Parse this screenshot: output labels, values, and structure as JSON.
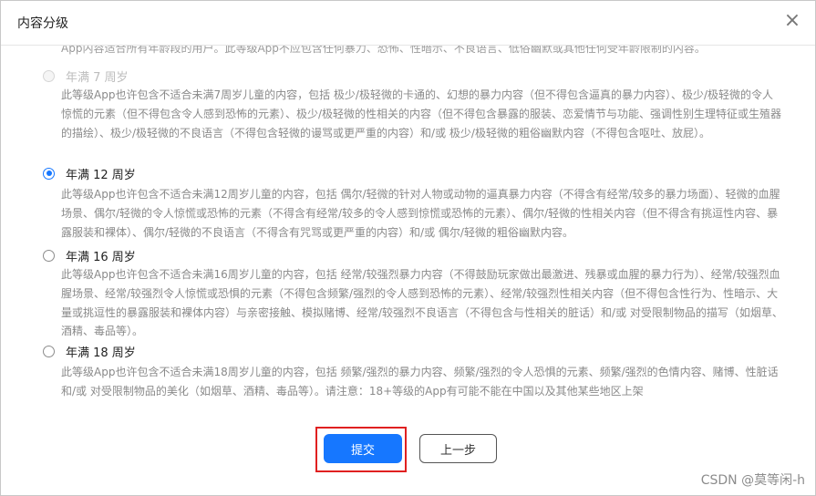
{
  "dialog": {
    "title": "内容分级",
    "close_glyph": "×"
  },
  "clipped_text": "App内容适合所有年龄段的用户。此等级App不应包含任何暴力、恐怖、性暗示、不良语言、低俗幽默或其他任何受年龄限制的内容。",
  "options": [
    {
      "label": "年满 7 周岁",
      "state": "disabled",
      "description": "此等级App也许包含不适合未满7周岁儿童的内容，包括 极少/极轻微的卡通的、幻想的暴力内容（但不得包含逼真的暴力内容）、极少/极轻微的令人惊慌的元素（但不得包含令人感到恐怖的元素）、极少/极轻微的性相关的内容（但不得包含暴露的服装、恋爱情节与功能、强调性别生理特征或生殖器的描绘）、极少/极轻微的不良语言（不得包含轻微的谩骂或更严重的内容）和/或 极少/极轻微的粗俗幽默内容（不得包含呕吐、放屁）。"
    },
    {
      "label": "年满 12 周岁",
      "state": "checked",
      "description": "此等级App也许包含不适合未满12周岁儿童的内容，包括 偶尔/轻微的针对人物或动物的逼真暴力内容（不得含有经常/较多的暴力场面）、轻微的血腥场景、偶尔/轻微的令人惊慌或恐怖的元素（不得含有经常/较多的令人感到惊慌或恐怖的元素）、偶尔/轻微的性相关内容（但不得含有挑逗性内容、暴露服装和裸体）、偶尔/轻微的不良语言（不得含有咒骂或更严重的内容）和/或 偶尔/轻微的粗俗幽默内容。"
    },
    {
      "label": "年满 16 周岁",
      "state": "unchecked",
      "description": "此等级App也许包含不适合未满16周岁儿童的内容，包括 经常/较强烈暴力内容（不得鼓励玩家做出最激进、残暴或血腥的暴力行为）、经常/较强烈血腥场景、经常/较强烈令人惊慌或恐惧的元素（不得包含频繁/强烈的令人感到恐怖的元素）、经常/较强烈性相关内容（但不得包含性行为、性暗示、大量或挑逗性的暴露服装和裸体内容）与亲密接触、模拟赌博、经常/较强烈不良语言（不得包含与性相关的脏话）和/或 对受限制物品的描写（如烟草、酒精、毒品等）。"
    },
    {
      "label": "年满 18 周岁",
      "state": "unchecked",
      "description": "此等级App也许包含不适合未满18周岁儿童的内容，包括 频繁/强烈的暴力内容、频繁/强烈的令人恐惧的元素、频繁/强烈的色情内容、赌博、性脏话和/或 对受限制物品的美化（如烟草、酒精、毒品等）。请注意：18+等级的App有可能不能在中国以及其他某些地区上架"
    }
  ],
  "footer": {
    "submit_label": "提交",
    "back_label": "上一步"
  },
  "watermark": "CSDN @莫等闲-h",
  "colors": {
    "accent": "#1677ff",
    "highlight_frame": "#e02020"
  }
}
